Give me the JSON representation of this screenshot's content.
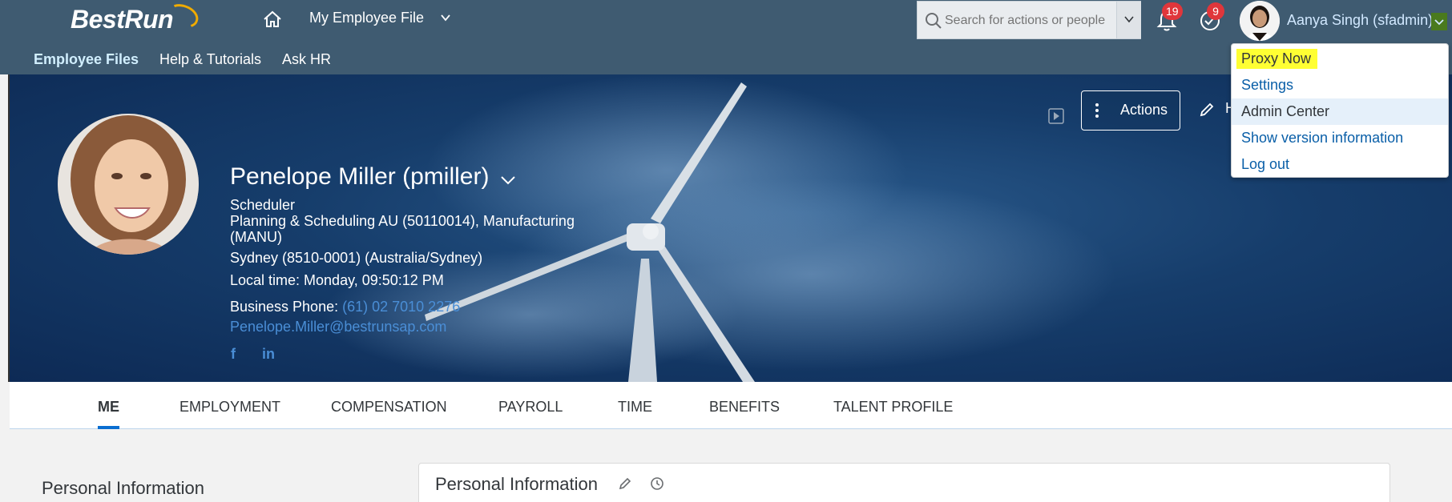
{
  "shell": {
    "logo": "BestRun",
    "module_title": "My Employee File",
    "search_placeholder": "Search for actions or people",
    "notifications_count": "19",
    "todo_count": "9",
    "user_name": "Aanya Singh (sfadmin)"
  },
  "subnav": {
    "items": [
      "Employee Files",
      "Help & Tutorials",
      "Ask HR"
    ]
  },
  "user_menu": {
    "items": [
      "Proxy Now",
      "Settings",
      "Admin Center",
      "Show version information",
      "Log out"
    ]
  },
  "hero": {
    "actions_label": "Actions",
    "edit_label": "H",
    "name": "Penelope Miller (pmiller)",
    "job_title": "Scheduler",
    "department_line1": "Planning & Scheduling AU (50110014), Manufacturing",
    "department_line2": "(MANU)",
    "location": "Sydney (8510-0001) (Australia/Sydney)",
    "local_time": "Local time: Monday, 09:50:12 PM",
    "phone_label": "Business Phone:",
    "phone_value": "(61) 02 7010 2276",
    "email": "Penelope.Miller@bestrunsap.com",
    "social": [
      "f",
      "in"
    ]
  },
  "tabs": [
    "ME",
    "EMPLOYMENT",
    "COMPENSATION",
    "PAYROLL",
    "TIME",
    "BENEFITS",
    "TALENT PROFILE"
  ],
  "content": {
    "left_section_title": "Personal Information",
    "card_title": "Personal Information"
  },
  "colors": {
    "shell_bg": "#3f5b71",
    "accent": "#0a6ed1",
    "badge": "#e0363b",
    "highlight": "#ffff33"
  }
}
